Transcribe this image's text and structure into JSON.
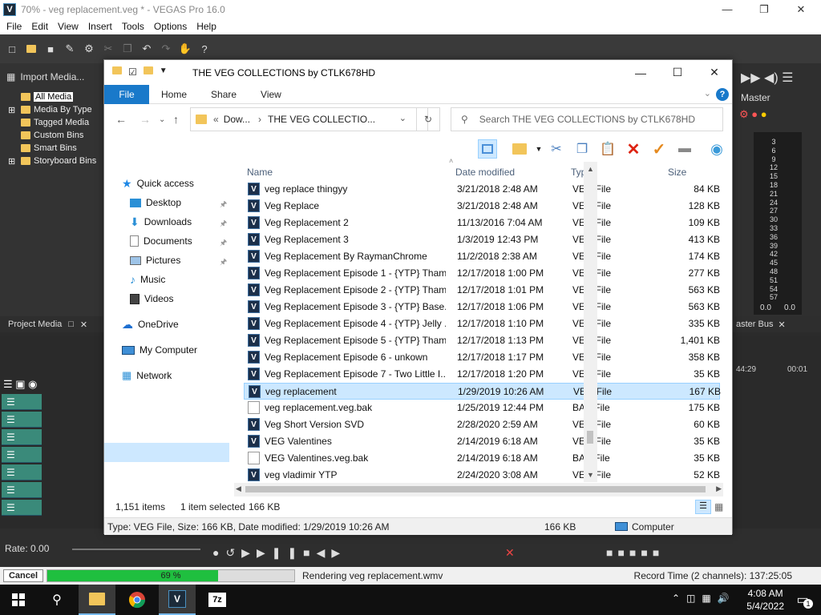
{
  "vegas": {
    "title": "70% - veg replacement.veg * - VEGAS Pro 16.0",
    "menu": [
      "File",
      "Edit",
      "View",
      "Insert",
      "Tools",
      "Options",
      "Help"
    ],
    "import_media": "Import Media...",
    "tree": [
      "All Media",
      "Media By Type",
      "Tagged Media",
      "Custom Bins",
      "Smart Bins",
      "Storyboard Bins"
    ],
    "project_media_tab": "Project Media",
    "master": "Master",
    "master_bus": "aster Bus",
    "meter_ticks": [
      "3",
      "6",
      "9",
      "12",
      "15",
      "18",
      "21",
      "24",
      "27",
      "30",
      "33",
      "36",
      "39",
      "42",
      "45",
      "48",
      "51",
      "54",
      "57"
    ],
    "meter_values": [
      "0.0",
      "0.0"
    ],
    "timecodes": [
      "44:29",
      "00:01"
    ],
    "rate": "Rate: 0.00",
    "cancel": "Cancel",
    "progress_text": "69 %",
    "progress_fraction": 0.69,
    "render_text": "Rendering veg replacement.wmv",
    "record_time": "Record Time (2 channels): 137:25:05"
  },
  "explorer": {
    "title": "THE VEG COLLECTIONS by CTLK678HD",
    "ribbon_tabs": [
      "File",
      "Home",
      "Share",
      "View"
    ],
    "address": [
      "«",
      "Dow...",
      "›",
      "THE VEG COLLECTIO..."
    ],
    "search_placeholder": "Search THE VEG COLLECTIONS by CTLK678HD",
    "nav": {
      "quick_access": "Quick access",
      "desktop": "Desktop",
      "downloads": "Downloads",
      "documents": "Documents",
      "pictures": "Pictures",
      "music": "Music",
      "videos": "Videos",
      "onedrive": "OneDrive",
      "my_computer": "My Computer",
      "network": "Network"
    },
    "columns": [
      "Name",
      "Date modified",
      "Type",
      "Size"
    ],
    "files": [
      {
        "name": "veg replace thingyy",
        "date": "3/21/2018 2:48 AM",
        "type": "VEG File",
        "size": "84 KB",
        "icon": "veg"
      },
      {
        "name": "Veg Replace",
        "date": "3/21/2018 2:48 AM",
        "type": "VEG File",
        "size": "128 KB",
        "icon": "veg"
      },
      {
        "name": "Veg Replacement 2",
        "date": "11/13/2016 7:04 AM",
        "type": "VEG File",
        "size": "109 KB",
        "icon": "veg"
      },
      {
        "name": "Veg Replacement 3",
        "date": "1/3/2019 12:43 PM",
        "type": "VEG File",
        "size": "413 KB",
        "icon": "veg"
      },
      {
        "name": "Veg Replacement By RaymanChrome",
        "date": "11/2/2018 2:38 AM",
        "type": "VEG File",
        "size": "174 KB",
        "icon": "veg"
      },
      {
        "name": "Veg Replacement Episode 1 - {YTP} Tham...",
        "date": "12/17/2018 1:00 PM",
        "type": "VEG File",
        "size": "277 KB",
        "icon": "veg"
      },
      {
        "name": "Veg Replacement Episode 2 - {YTP} Tham...",
        "date": "12/17/2018 1:01 PM",
        "type": "VEG File",
        "size": "563 KB",
        "icon": "veg"
      },
      {
        "name": "Veg Replacement Episode 3 - {YTP} Base...",
        "date": "12/17/2018 1:06 PM",
        "type": "VEG File",
        "size": "563 KB",
        "icon": "veg"
      },
      {
        "name": "Veg Replacement Episode 4 - {YTP} Jelly ...",
        "date": "12/17/2018 1:10 PM",
        "type": "VEG File",
        "size": "335 KB",
        "icon": "veg"
      },
      {
        "name": "Veg Replacement Episode 5 - {YTP} Tham...",
        "date": "12/17/2018 1:13 PM",
        "type": "VEG File",
        "size": "1,401 KB",
        "icon": "veg"
      },
      {
        "name": "Veg Replacement Episode 6 - unkown",
        "date": "12/17/2018 1:17 PM",
        "type": "VEG File",
        "size": "358 KB",
        "icon": "veg"
      },
      {
        "name": "Veg Replacement Episode 7 - Two Little I...",
        "date": "12/17/2018 1:20 PM",
        "type": "VEG File",
        "size": "35 KB",
        "icon": "veg"
      },
      {
        "name": "veg replacement",
        "date": "1/29/2019 10:26 AM",
        "type": "VEG File",
        "size": "167 KB",
        "icon": "veg",
        "selected": true
      },
      {
        "name": "veg replacement.veg.bak",
        "date": "1/25/2019 12:44 PM",
        "type": "BAK File",
        "size": "175 KB",
        "icon": "bak"
      },
      {
        "name": "Veg Short Version SVD",
        "date": "2/28/2020 2:59 AM",
        "type": "VEG File",
        "size": "60 KB",
        "icon": "veg"
      },
      {
        "name": "VEG Valentines",
        "date": "2/14/2019 6:18 AM",
        "type": "VEG File",
        "size": "35 KB",
        "icon": "veg"
      },
      {
        "name": "VEG Valentines.veg.bak",
        "date": "2/14/2019 6:18 AM",
        "type": "BAK File",
        "size": "35 KB",
        "icon": "bak"
      },
      {
        "name": "veg vladimir YTP",
        "date": "2/24/2020 3:08 AM",
        "type": "VEG File",
        "size": "52 KB",
        "icon": "veg"
      }
    ],
    "status_items": "1,151 items",
    "status_selected": "1 item selected",
    "status_size": "166 KB",
    "bottom_info": "Type: VEG File, Size: 166 KB, Date modified: 1/29/2019 10:26 AM",
    "bottom_size": "166 KB",
    "bottom_location": "Computer"
  },
  "taskbar": {
    "time": "4:08 AM",
    "date": "5/4/2022",
    "notification_count": "1"
  }
}
